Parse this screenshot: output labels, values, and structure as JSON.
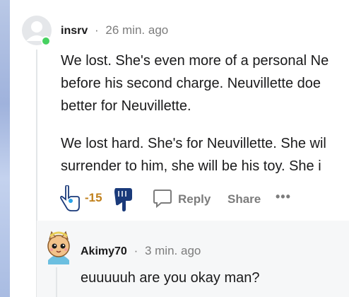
{
  "comment": {
    "username": "insrv",
    "separator": "·",
    "time": "26 min. ago",
    "paragraph1": [
      "We lost. She's even more of a personal Ne",
      "before his second charge. Neuvillette doe",
      "better for Neuvillette."
    ],
    "paragraph2": [
      "We lost hard. She's for Neuvillette. She wil",
      "surrender to him, she will be his toy. She i"
    ],
    "score": "-15",
    "reply_label": "Reply",
    "share_label": "Share",
    "more_label": "•••"
  },
  "reply": {
    "username": "Akimy70",
    "separator": "·",
    "time": "3 min. ago",
    "text": "euuuuuh are you okay man?"
  },
  "colors": {
    "online": "#46d160",
    "score": "#c1811d",
    "muted": "#7c7c7c"
  }
}
